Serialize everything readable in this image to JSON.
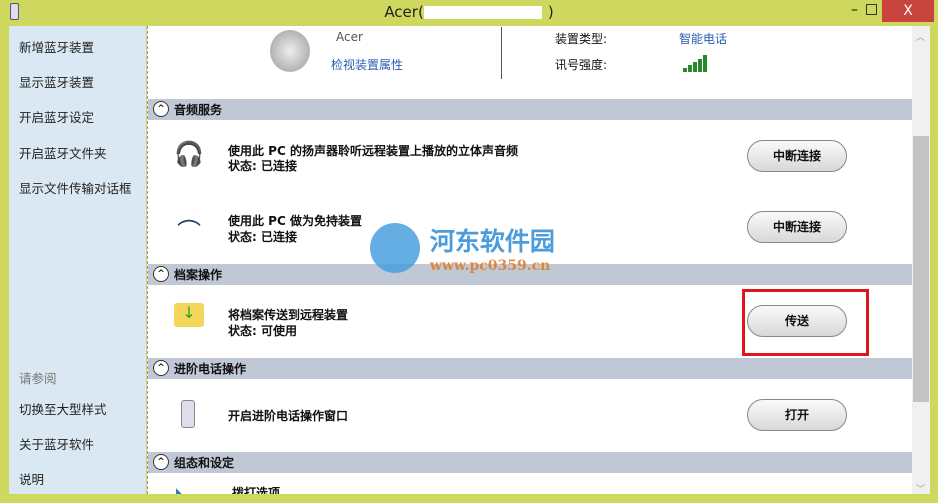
{
  "window": {
    "title": "Acer(",
    "title_suffix": ")",
    "close": "X",
    "minimize": "–"
  },
  "sidebar": {
    "items": [
      "新增蓝牙装置",
      "显示蓝牙装置",
      "开启蓝牙设定",
      "开启蓝牙文件夹",
      "显示文件传输对话框"
    ],
    "see_also": "请参阅",
    "see_also_items": [
      "切换至大型样式",
      "关于蓝牙软件",
      "说明"
    ]
  },
  "device": {
    "name": "Acer",
    "properties_link": "检视装置属性",
    "type_label": "装置类型:",
    "type_value": "智能电话",
    "signal_label": "讯号强度:"
  },
  "sections": [
    {
      "title": "音频服务",
      "items": [
        {
          "text": "使用此 PC 的扬声器聆听远程装置上播放的立体声音频",
          "status": "状态:  已连接",
          "button": "中断连接"
        },
        {
          "text": "使用此 PC 做为免持装置",
          "status": "状态:  已连接",
          "button": "中断连接"
        }
      ]
    },
    {
      "title": "档案操作",
      "items": [
        {
          "text": "将档案传送到远程装置",
          "status": "状态:  可使用",
          "button": "传送"
        }
      ]
    },
    {
      "title": "进阶电话操作",
      "items": [
        {
          "text": "开启进阶电话操作窗口",
          "button": "打开"
        }
      ]
    },
    {
      "title": "组态和设定",
      "items": [
        {
          "text": "拨打选项"
        }
      ]
    }
  ],
  "watermark": {
    "name": "河东软件园",
    "url": "www.pc0359.cn"
  }
}
